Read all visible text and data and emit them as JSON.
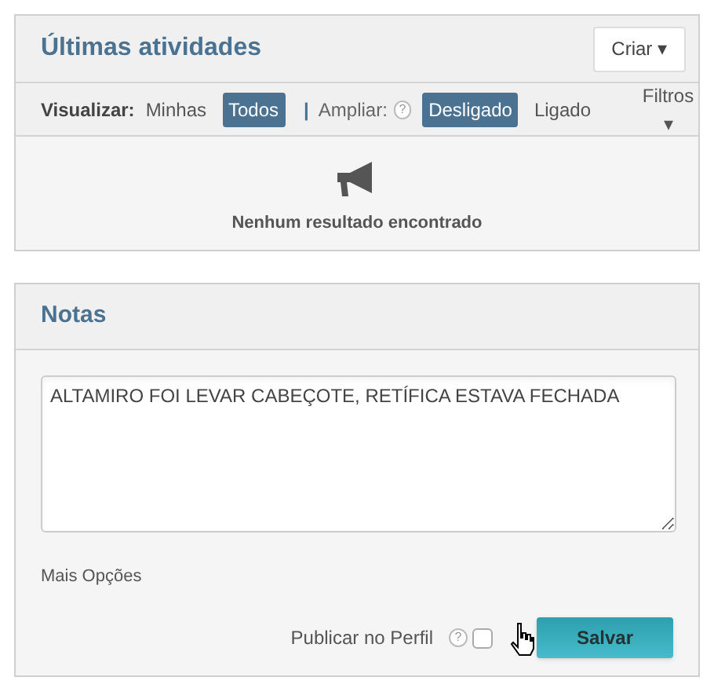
{
  "activity_panel": {
    "title": "Últimas atividades",
    "create_button": "Criar ▾",
    "view": {
      "label": "Visualizar:",
      "options": [
        {
          "label": "Minhas",
          "selected": false
        },
        {
          "label": "Todos",
          "selected": true
        }
      ]
    },
    "separator": "|",
    "expand": {
      "label": "Ampliar:",
      "help": "?",
      "options": [
        {
          "label": "Desligado",
          "selected": true
        },
        {
          "label": "Ligado",
          "selected": false
        }
      ]
    },
    "filters_button": "Filtros ▾",
    "empty_message": "Nenhum resultado encontrado"
  },
  "notes_panel": {
    "title": "Notas",
    "note_text": "ALTAMIRO FOI LEVAR CABEÇOTE, RETÍFICA ESTAVA FECHADA",
    "more_options": "Mais Opções",
    "publish_label": "Publicar no Perfil",
    "publish_help": "?",
    "publish_checked": false,
    "save_button": "Salvar"
  }
}
